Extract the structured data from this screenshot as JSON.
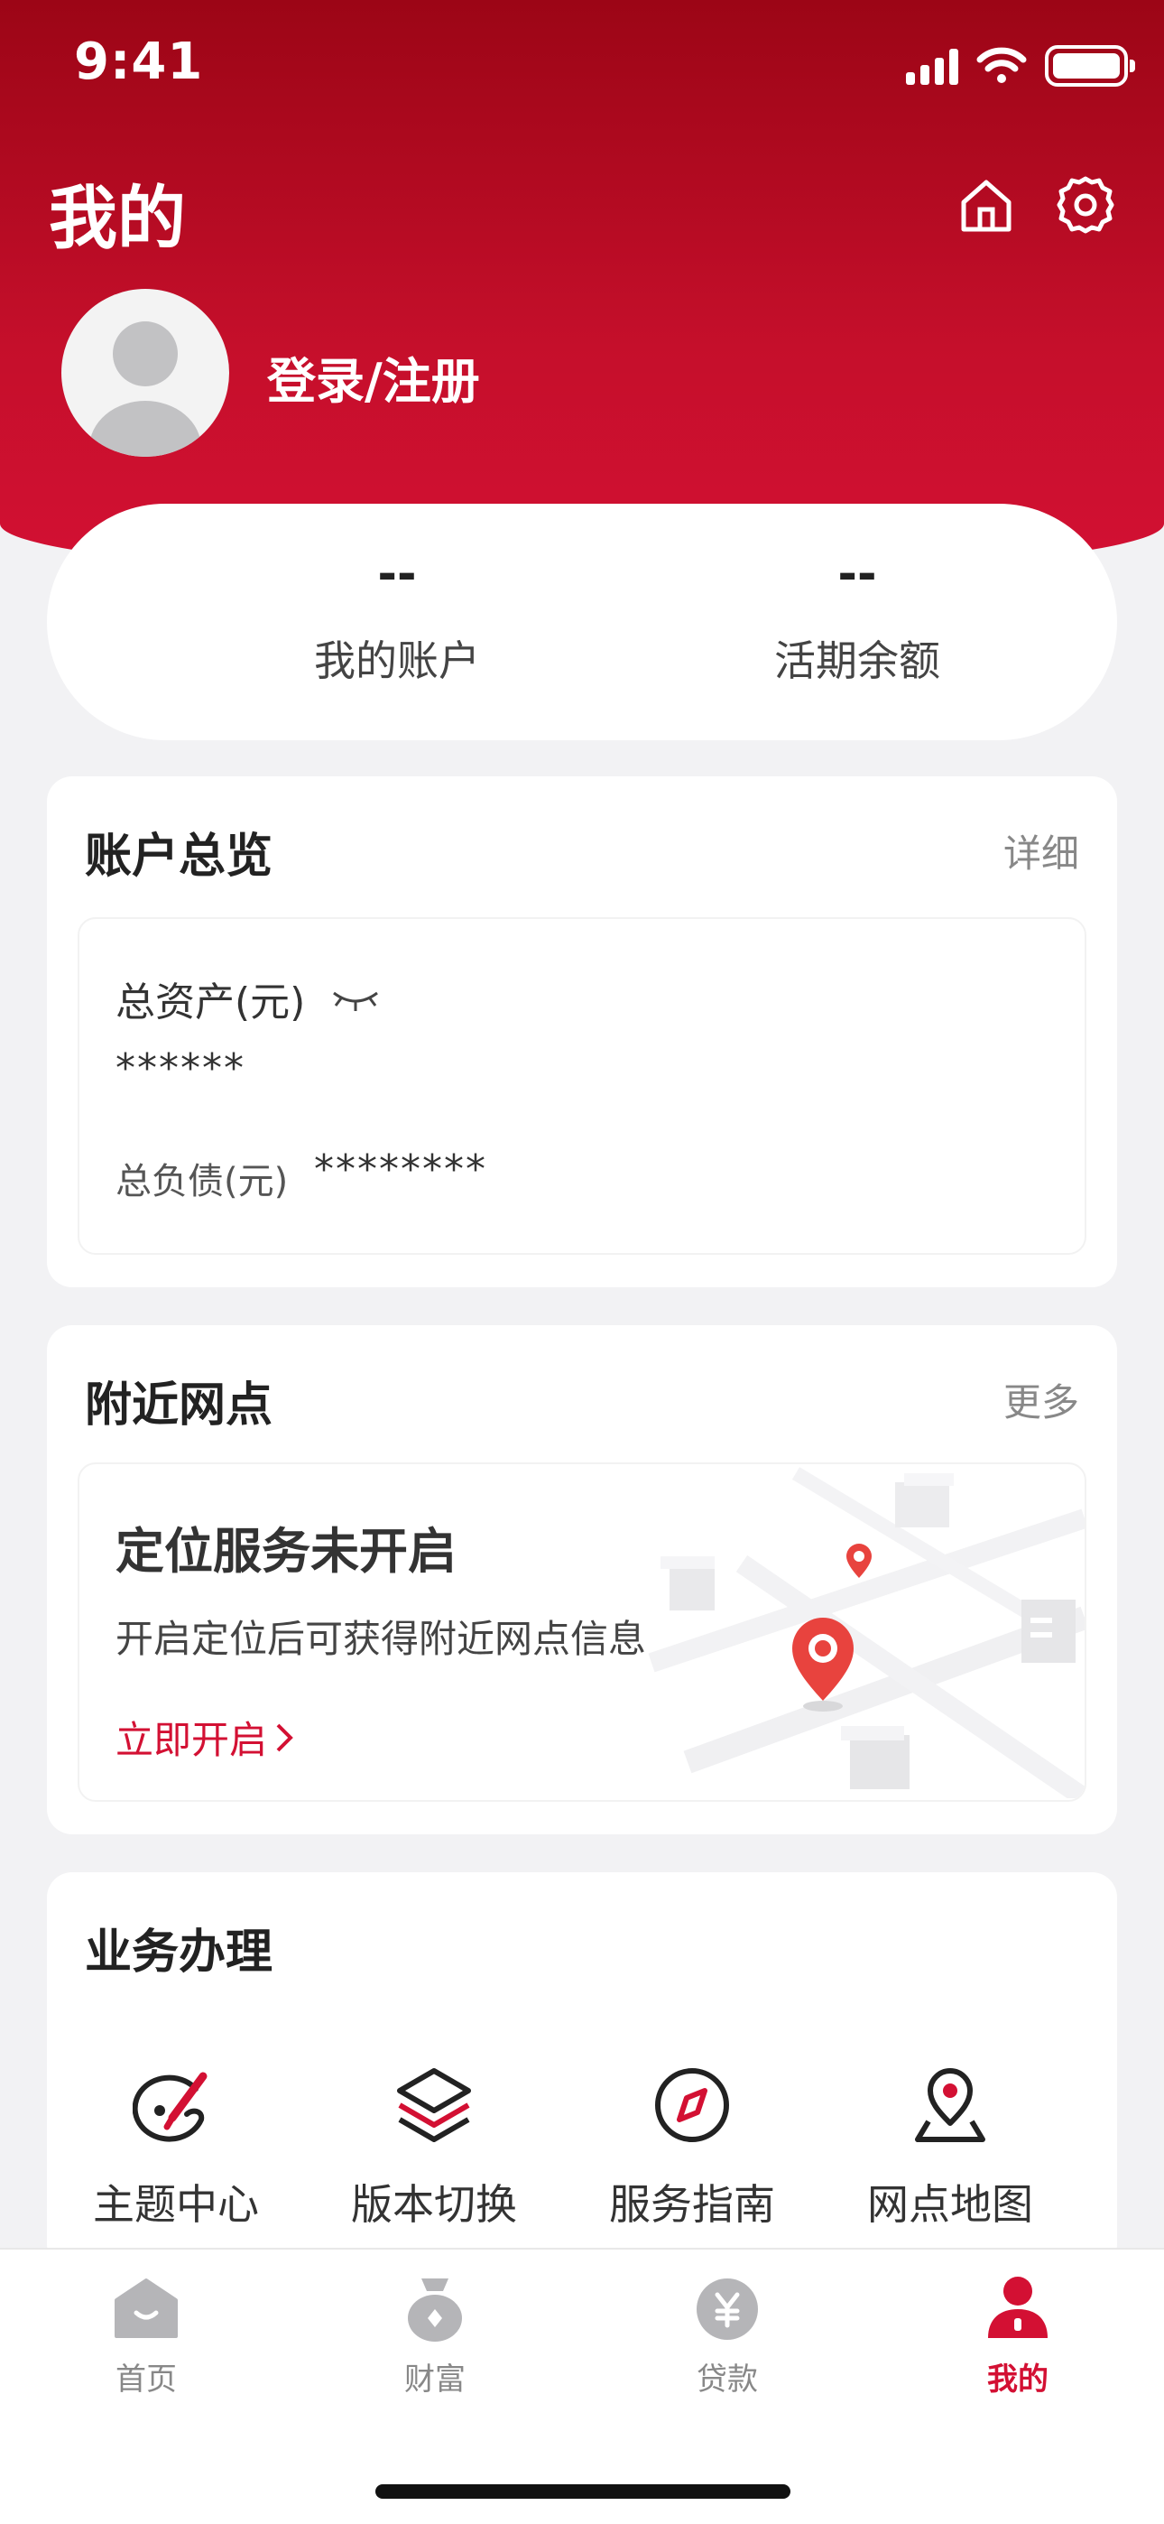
{
  "status_bar": {
    "time": "9:41"
  },
  "header": {
    "title": "我的",
    "login_text": "登录/注册"
  },
  "stats": [
    {
      "value": "--",
      "label": "我的账户"
    },
    {
      "value": "--",
      "label": "活期余额"
    }
  ],
  "account_overview": {
    "title": "账户总览",
    "link": "详细",
    "total_assets_label": "总资产(元)",
    "total_assets_value": "******",
    "total_debt_label": "总负债(元)",
    "total_debt_value": "********"
  },
  "nearby_branches": {
    "title": "附近网点",
    "link": "更多",
    "location_title": "定位服务未开启",
    "location_desc": "开启定位后可获得附近网点信息",
    "enable_link": "立即开启"
  },
  "services": {
    "title": "业务办理",
    "items": [
      {
        "label": "主题中心",
        "icon": "palette-icon"
      },
      {
        "label": "版本切换",
        "icon": "layers-icon"
      },
      {
        "label": "服务指南",
        "icon": "compass-icon"
      },
      {
        "label": "网点地图",
        "icon": "map-pin-icon"
      }
    ]
  },
  "tabbar": {
    "items": [
      {
        "label": "首页",
        "icon": "home-tab-icon",
        "active": false
      },
      {
        "label": "财富",
        "icon": "wealth-tab-icon",
        "active": false
      },
      {
        "label": "贷款",
        "icon": "loan-tab-icon",
        "active": false
      },
      {
        "label": "我的",
        "icon": "mine-tab-icon",
        "active": true
      }
    ]
  },
  "colors": {
    "brand_red": "#d31033",
    "header_dark_red": "#9c0516",
    "inactive_gray": "#b5b5b8"
  }
}
